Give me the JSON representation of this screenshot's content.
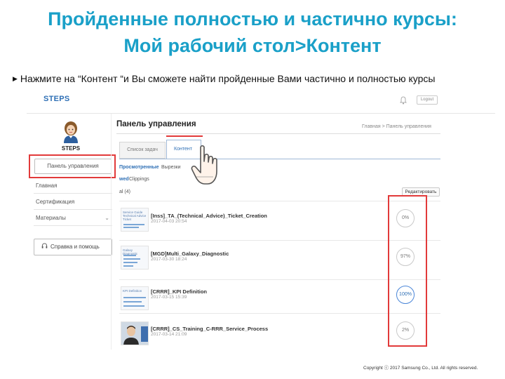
{
  "slide": {
    "title_line1": "Пройденные полностью и частично курсы:",
    "title_line2": "Мой рабочий стол>Контент",
    "bullet": "Нажмите на “Контент “и Вы сможете найти пройденные Вами частично и полностью курсы",
    "copyright": "Copyright ⓒ 2017 Samsung Co., Ltd. All rights reserved."
  },
  "app": {
    "logo": "STEPS",
    "logout": "Logout",
    "user_label": "STEPS",
    "panel_button": "Панель управления",
    "nav": [
      {
        "label": "Главная"
      },
      {
        "label": "Сертификация"
      },
      {
        "label": "Материалы",
        "chevron": "⌄"
      }
    ],
    "help_button": "Справка и помощь",
    "main_title": "Панель управления",
    "breadcrumb": "Главная  >  Панель управления",
    "tabs": [
      "Список задач",
      "Контент"
    ],
    "subtabs": [
      "Просмотренные",
      "Вырезки"
    ],
    "subtabs_en": [
      "wed",
      "Clippings"
    ],
    "total": "al (4)",
    "edit_button": "Редактировать",
    "courses": [
      {
        "title": "[Inss]_TA_(Technical_Advice)_Ticket_Creation",
        "date": "2017-04-03 20:54",
        "progress": "0%"
      },
      {
        "title": "[MGD]Multi_Galaxy_Diagnostic",
        "date": "2017-03-30 18:24",
        "progress": "97%"
      },
      {
        "title": "[CRRR]_KPI Definition",
        "date": "2017-03-15 15:39",
        "progress": "100%"
      },
      {
        "title": "[CRRR]_CS_Training_C-RRR_Service_Process",
        "date": "2017-03-14 21:09",
        "progress": "2%"
      }
    ],
    "thumb_texts": [
      "Service Guide Technical Advice Ticket",
      "Galaxy Diagnostic",
      "KPI Definition",
      ""
    ]
  },
  "colors": {
    "title": "#1aa0c8",
    "highlight_red": "#e23a3a",
    "link_blue": "#2e6fb5"
  },
  "icons": [
    "bell-icon",
    "avatar-icon",
    "headset-icon",
    "hand-pointer-icon",
    "chevron-down-icon"
  ]
}
